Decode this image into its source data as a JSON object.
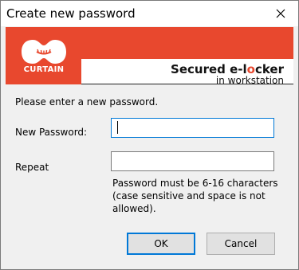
{
  "window": {
    "title": "Create new password",
    "close_icon": "close-icon"
  },
  "banner": {
    "logo_text": "CURTAIN",
    "product_prefix": "Secured e-l",
    "product_accent": "o",
    "product_suffix": "cker",
    "product_subtitle": "in workstation",
    "accent_color": "#e8482e"
  },
  "form": {
    "prompt": "Please enter a new password.",
    "new_password_label": "New Password:",
    "new_password_value": "",
    "repeat_label": "Repeat",
    "repeat_value": "",
    "hint": "Password must be 6-16 characters (case sensitive and space is not allowed)."
  },
  "buttons": {
    "ok_label": "OK",
    "cancel_label": "Cancel"
  }
}
